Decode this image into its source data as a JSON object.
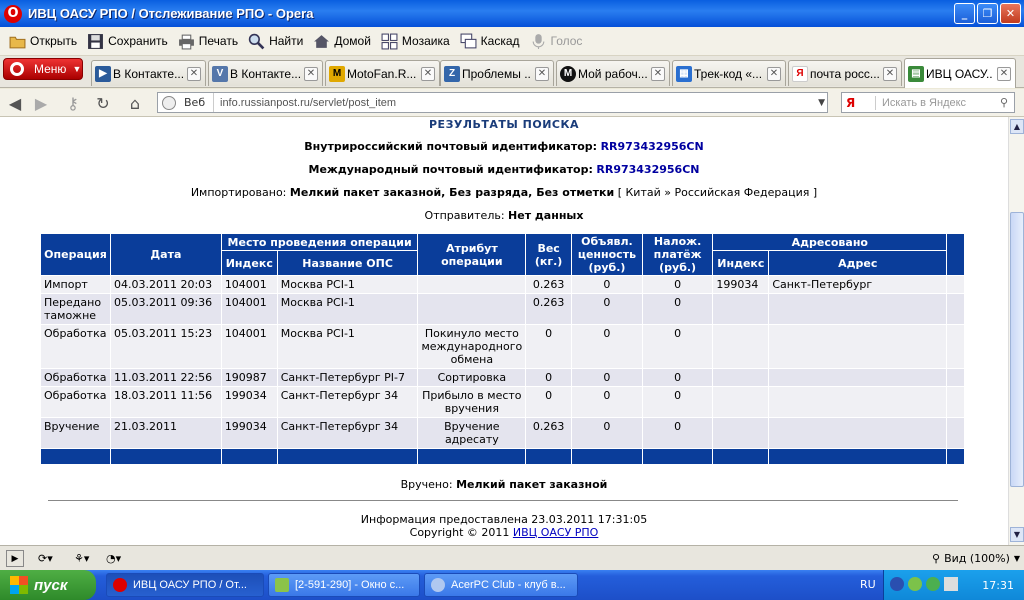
{
  "window": {
    "title": "ИВЦ ОАСУ РПО / Отслеживание РПО - Opera",
    "min": "_",
    "max": "❐",
    "close": "✕"
  },
  "toolbar": {
    "items": [
      {
        "label": "Открыть",
        "icon": "folder-icon"
      },
      {
        "label": "Сохранить",
        "icon": "floppy-icon"
      },
      {
        "label": "Печать",
        "icon": "printer-icon"
      },
      {
        "label": "Найти",
        "icon": "magnifier-icon"
      },
      {
        "label": "Домой",
        "icon": "home-icon"
      },
      {
        "label": "Мозаика",
        "icon": "tile-icon"
      },
      {
        "label": "Каскад",
        "icon": "cascade-icon"
      },
      {
        "label": "Голос",
        "icon": "microphone-icon"
      }
    ]
  },
  "menu_label": "Меню",
  "tabs": [
    {
      "label": "В Контакте...",
      "fav": "▶",
      "color": "#2a5a9a"
    },
    {
      "label": "В Контакте...",
      "fav": "V",
      "color": "#5577aa"
    },
    {
      "label": "MotoFan.R...",
      "fav": "M",
      "color": "#e0a800"
    },
    {
      "label": "Проблемы ...",
      "fav": "Z",
      "color": "#3366aa"
    },
    {
      "label": "Мой рабоч...",
      "fav": "M",
      "color": "#111111"
    },
    {
      "label": "Трек-код «...",
      "fav": "▦",
      "color": "#2a6fd0"
    },
    {
      "label": "почта росс...",
      "fav": "Я",
      "color": "#ffffff"
    },
    {
      "label": "ИВЦ ОАСУ...",
      "fav": "▤",
      "color": "#3a8a3a"
    }
  ],
  "address": {
    "engine": "Веб",
    "url": "info.russianpost.ru/servlet/post_item"
  },
  "search": {
    "logo": "Я",
    "placeholder": "Искать в Яндекс"
  },
  "page": {
    "heading": "РЕЗУЛЬТАТЫ ПОИСКА",
    "domestic_label": "Внутрироссийский почтовый идентификатор:",
    "domestic_id": "RR973432956CN",
    "intl_label": "Международный почтовый идентификатор:",
    "intl_id": "RR973432956CN",
    "imported_label": "Импортировано:",
    "imported_value": "Мелкий пакет заказной, Без разряда, Без отметки",
    "route": "[ Китай » Российская Федерация ]",
    "sender_label": "Отправитель:",
    "sender_value": "Нет данных",
    "delivered_label": "Вручено:",
    "delivered_value": "Мелкий пакет заказной",
    "info_text": "Информация предоставлена 23.03.2011 17:31:05",
    "copyright": "Copyright © 2011",
    "copyright_link": "ИВЦ ОАСУ РПО"
  },
  "table": {
    "headers": {
      "operation": "Операция",
      "date": "Дата",
      "place": "Место проведения операции",
      "index": "Индекс",
      "ops_name": "Название ОПС",
      "attribute": "Атрибут операции",
      "weight": "Вес (кг.)",
      "declared": "Объявл. ценность (руб.)",
      "cod": "Налож. платёж (руб.)",
      "addressed": "Адресовано",
      "addr_index": "Индекс",
      "address": "Адрес"
    },
    "rows": [
      {
        "op": "Импорт",
        "date": "04.03.2011 20:03",
        "idx": "104001",
        "name": "Москва PCI-1",
        "attr": "",
        "w": "0.263",
        "dv": "0",
        "cod": "0",
        "aidx": "199034",
        "addr": "Санкт-Петербург"
      },
      {
        "op": "Передано таможне",
        "date": "05.03.2011 09:36",
        "idx": "104001",
        "name": "Москва PCI-1",
        "attr": "",
        "w": "0.263",
        "dv": "0",
        "cod": "0",
        "aidx": "",
        "addr": ""
      },
      {
        "op": "Обработка",
        "date": "05.03.2011 15:23",
        "idx": "104001",
        "name": "Москва PCI-1",
        "attr": "Покинуло место международного обмена",
        "w": "0",
        "dv": "0",
        "cod": "0",
        "aidx": "",
        "addr": ""
      },
      {
        "op": "Обработка",
        "date": "11.03.2011 22:56",
        "idx": "190987",
        "name": "Санкт-Петербург PI-7",
        "attr": "Сортировка",
        "w": "0",
        "dv": "0",
        "cod": "0",
        "aidx": "",
        "addr": ""
      },
      {
        "op": "Обработка",
        "date": "18.03.2011 11:56",
        "idx": "199034",
        "name": "Санкт-Петербург 34",
        "attr": "Прибыло в место вручения",
        "w": "0",
        "dv": "0",
        "cod": "0",
        "aidx": "",
        "addr": ""
      },
      {
        "op": "Вручение",
        "date": "21.03.2011",
        "idx": "199034",
        "name": "Санкт-Петербург 34",
        "attr": "Вручение адресату",
        "w": "0.263",
        "dv": "0",
        "cod": "0",
        "aidx": "",
        "addr": ""
      }
    ]
  },
  "status": {
    "zoom": "Вид (100%)"
  },
  "taskbar": {
    "start": "пуск",
    "tasks": [
      "ИВЦ ОАСУ РПО / От...",
      "[2-591-290] - Окно с...",
      "AcerPC Club - клуб в..."
    ],
    "lang": "RU",
    "clock": "17:31"
  }
}
